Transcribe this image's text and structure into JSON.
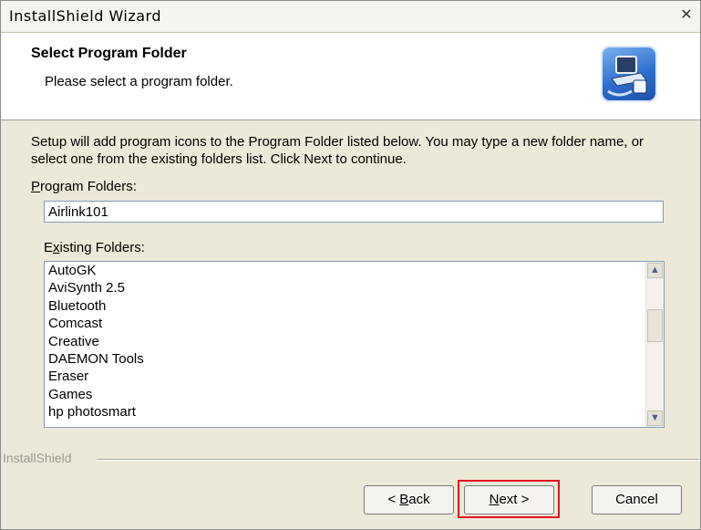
{
  "window": {
    "title": "InstallShield Wizard"
  },
  "header": {
    "title": "Select Program Folder",
    "subtitle": "Please select a program folder.",
    "icon": "installshield-computer-icon"
  },
  "intro_text": "Setup will add program icons to the Program Folder listed below.  You may type a new folder name, or select one from the existing folders list.  Click Next to continue.",
  "program_folders": {
    "label_first": "P",
    "label_rest": "rogram Folders:",
    "value": "Airlink101"
  },
  "existing_folders": {
    "label_first": "E",
    "label_mid": "x",
    "label_rest": "isting Folders:",
    "items": [
      "AutoGK",
      "AviSynth 2.5",
      "Bluetooth",
      "Comcast",
      "Creative",
      "DAEMON Tools",
      "Eraser",
      "Games",
      "hp photosmart"
    ]
  },
  "brand": "InstallShield",
  "buttons": {
    "back_prefix": "< ",
    "back_key": "B",
    "back_rest": "ack",
    "next_key": "N",
    "next_rest": "ext >",
    "cancel": "Cancel"
  },
  "colors": {
    "highlight": "#e0141d",
    "header_bg": "#ffffff",
    "dialog_bg": "#ece9d8"
  }
}
